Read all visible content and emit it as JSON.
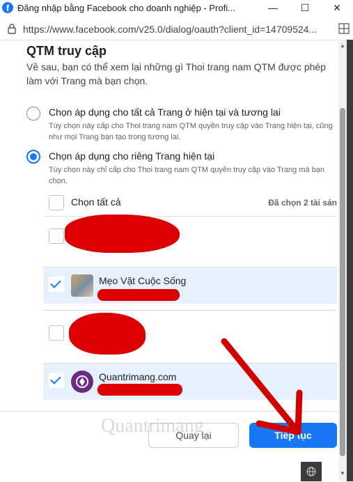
{
  "window": {
    "title": "Đăng nhập bằng Facebook cho doanh nghiệp - Profi..."
  },
  "address": {
    "url": "https://www.facebook.com/v25.0/dialog/oauth?client_id=14709524..."
  },
  "dialog": {
    "title": "QTM truy cập",
    "description": "Về sau, bạn có thể xem lại những gì Thoi trang nam QTM được phép làm với Trang mà bạn chọn.",
    "options": [
      {
        "label": "Chọn áp dụng cho tất cả Trang ở hiện tại và tương lai",
        "description": "Tùy chọn này cấp cho Thoi trang nam QTM quyền truy cập vào Trang hiện tại, cũng như mọi Trang bạn tạo trong tương lai.",
        "selected": false
      },
      {
        "label": "Chọn áp dụng cho riêng Trang hiện tại",
        "description": "Tùy chọn này chỉ cấp cho Thoi trang nam QTM quyền truy cập vào Trang mà bạn chọn.",
        "selected": true
      }
    ],
    "select_all_label": "Chọn tất cả",
    "selected_count": "Đã chọn 2 tài sản",
    "pages": [
      {
        "name": "",
        "checked": false
      },
      {
        "name": "Mẹo Vặt Cuộc Sống",
        "checked": true
      },
      {
        "name": "",
        "checked": false
      },
      {
        "name": "Quantrimang.com",
        "checked": true
      }
    ],
    "back_label": "Quay lại",
    "continue_label": "Tiếp tục"
  },
  "watermark": "Quantrimang",
  "colors": {
    "accent": "#1877f2",
    "redaction": "#dc0000"
  }
}
